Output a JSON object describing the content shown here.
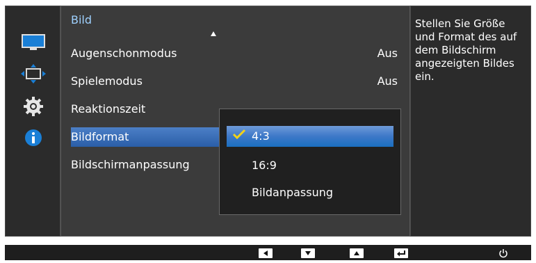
{
  "colors": {
    "menu_title": "#9fd1ff",
    "selection": "#2a5ea8",
    "submenu_selection": "#1a6fc0",
    "check": "#f2d21a",
    "panel_bg": "#3b3b3b",
    "sidebar_bg": "#2b2b2b"
  },
  "sidebar": {
    "items": [
      {
        "icon": "monitor-icon"
      },
      {
        "icon": "resize-arrows-icon"
      },
      {
        "icon": "gear-icon"
      },
      {
        "icon": "info-icon"
      }
    ]
  },
  "menu": {
    "title": "Bild",
    "items": [
      {
        "label": "Augenschonmodus",
        "value": "Aus"
      },
      {
        "label": "Spielemodus",
        "value": "Aus"
      },
      {
        "label": "Reaktionszeit",
        "value": ""
      },
      {
        "label": "Bildformat",
        "value": ""
      },
      {
        "label": "Bildschirmanpassung",
        "value": ""
      }
    ],
    "selected": "Bildformat"
  },
  "submenu": {
    "items": [
      {
        "label": "4:3"
      },
      {
        "label": "16:9"
      },
      {
        "label": "Bildanpassung"
      }
    ],
    "selected": "4:3"
  },
  "help": {
    "text": "Stellen Sie Größe und Format des auf dem Bildschirm angezeigten Bildes ein."
  },
  "bottom_keys": [
    {
      "icon": "left-arrow-icon"
    },
    {
      "icon": "down-arrow-icon"
    },
    {
      "icon": "up-arrow-icon"
    },
    {
      "icon": "enter-icon"
    },
    {
      "icon": "power-icon"
    }
  ]
}
